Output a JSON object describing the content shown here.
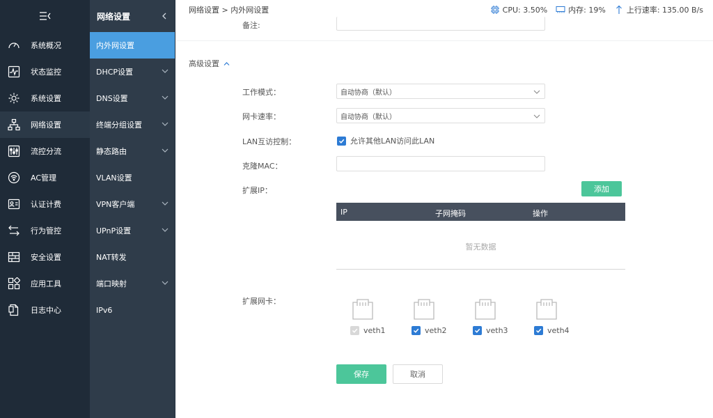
{
  "sidebar": {
    "items": [
      {
        "label": "系统概况",
        "icon": "gauge-icon"
      },
      {
        "label": "状态监控",
        "icon": "pulse-icon"
      },
      {
        "label": "系统设置",
        "icon": "gear-icon"
      },
      {
        "label": "网络设置",
        "icon": "network-icon"
      },
      {
        "label": "流控分流",
        "icon": "sliders-icon"
      },
      {
        "label": "AC管理",
        "icon": "wifi-icon"
      },
      {
        "label": "认证计费",
        "icon": "id-card-icon"
      },
      {
        "label": "行为管控",
        "icon": "arrows-icon"
      },
      {
        "label": "安全设置",
        "icon": "firewall-icon"
      },
      {
        "label": "应用工具",
        "icon": "apps-icon"
      },
      {
        "label": "日志中心",
        "icon": "log-icon"
      }
    ]
  },
  "subnav": {
    "title": "网络设置",
    "items": [
      {
        "label": "内外网设置"
      },
      {
        "label": "DHCP设置"
      },
      {
        "label": "DNS设置"
      },
      {
        "label": "终端分组设置"
      },
      {
        "label": "静态路由"
      },
      {
        "label": "VLAN设置"
      },
      {
        "label": "VPN客户端"
      },
      {
        "label": "UPnP设置"
      },
      {
        "label": "NAT转发"
      },
      {
        "label": "端口映射"
      },
      {
        "label": "IPv6"
      }
    ]
  },
  "topbar": {
    "breadcrumb": "网络设置 > 内外网设置",
    "cpu": "CPU: 3.50%",
    "memory": "内存: 19%",
    "upload": "上行速率: 135.00 B/s"
  },
  "form": {
    "note_label": "备注:",
    "advanced_label": "高级设置",
    "work_mode_label": "工作模式：",
    "work_mode_value": "自动协商（默认）",
    "nic_speed_label": "网卡速率：",
    "nic_speed_value": "自动协商（默认）",
    "lan_label": "LAN互访控制：",
    "lan_checkbox_label": "允许其他LAN访问此LAN",
    "clone_mac_label": "克隆MAC：",
    "ext_ip_label": "扩展IP：",
    "add_button": "添加",
    "table_headers": [
      "IP",
      "子网掩码",
      "操作"
    ],
    "empty_text": "暂无数据",
    "ext_nic_label": "扩展网卡：",
    "nics": [
      "veth1",
      "veth2",
      "veth3",
      "veth4"
    ],
    "save_button": "保存",
    "cancel_button": "取消"
  }
}
